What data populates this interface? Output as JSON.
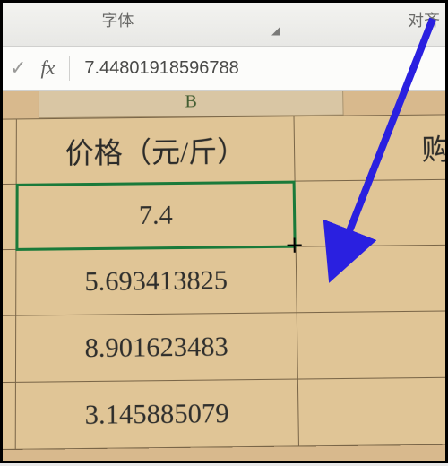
{
  "ribbon": {
    "font_group_label": "字体",
    "align_group_label": "对齐"
  },
  "formula_bar": {
    "fx_label": "fx",
    "value": "7.44801918596788"
  },
  "sheet": {
    "column_b_label": "B",
    "header_b": "价格（元/斤）",
    "header_c": "购",
    "rows": [
      {
        "b": "7.4",
        "c": ""
      },
      {
        "b": "5.693413825",
        "c": ""
      },
      {
        "b": "8.901623483",
        "c": ""
      },
      {
        "b": "3.145885079",
        "c": ""
      }
    ],
    "selected_cell_value": "7.4"
  },
  "chart_data": {
    "type": "table",
    "title": "价格（元/斤）",
    "columns": [
      "B"
    ],
    "values": [
      7.4,
      5.693413825,
      8.901623483,
      3.145885079
    ],
    "formula_bar_full_value": 7.44801918596788
  },
  "colors": {
    "selection_border": "#1a7a3a",
    "arrow": "#2a20e0",
    "sheet_bg": "#e0c596"
  }
}
